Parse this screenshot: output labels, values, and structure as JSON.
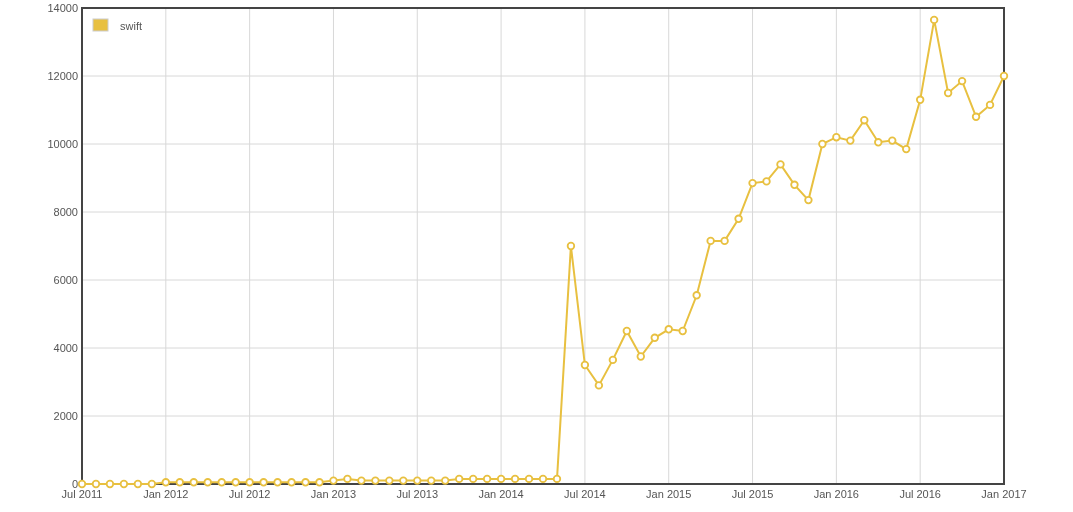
{
  "chart_data": {
    "type": "line",
    "categories": [
      "Jul 2011",
      null,
      null,
      null,
      null,
      null,
      "Jan 2012",
      null,
      null,
      null,
      null,
      null,
      "Jul 2012",
      null,
      null,
      null,
      null,
      null,
      "Jan 2013",
      null,
      null,
      null,
      null,
      null,
      "Jul 2013",
      null,
      null,
      null,
      null,
      null,
      "Jan 2014",
      null,
      null,
      null,
      null,
      null,
      "Jul 2014",
      null,
      null,
      null,
      null,
      null,
      "Jan 2015",
      null,
      null,
      null,
      null,
      null,
      "Jul 2015",
      null,
      null,
      null,
      null,
      null,
      "Jan 2016",
      null,
      null,
      null,
      null,
      null,
      "Jul 2016",
      null,
      null,
      null,
      null,
      null,
      "Jan 2017"
    ],
    "series": [
      {
        "name": "swift",
        "color": "#e8c040",
        "marker": true,
        "values": [
          0,
          0,
          0,
          0,
          0,
          0,
          50,
          50,
          50,
          50,
          50,
          50,
          50,
          50,
          50,
          50,
          50,
          50,
          100,
          150,
          100,
          100,
          100,
          100,
          100,
          100,
          100,
          150,
          150,
          150,
          150,
          150,
          150,
          150,
          150,
          7000,
          3500,
          2900,
          3650,
          4500,
          3750,
          4300,
          4550,
          4500,
          5550,
          7150,
          7150,
          7800,
          8850,
          8900,
          9400,
          8800,
          8350,
          10000,
          10200,
          10100,
          10700,
          10050,
          10100,
          9850,
          11300,
          13650,
          11500,
          11850,
          10800,
          11150,
          12000
        ]
      }
    ],
    "grid": true,
    "ylim": [
      0,
      14000
    ],
    "yticks": [
      0,
      2000,
      4000,
      6000,
      8000,
      10000,
      12000,
      14000
    ]
  }
}
